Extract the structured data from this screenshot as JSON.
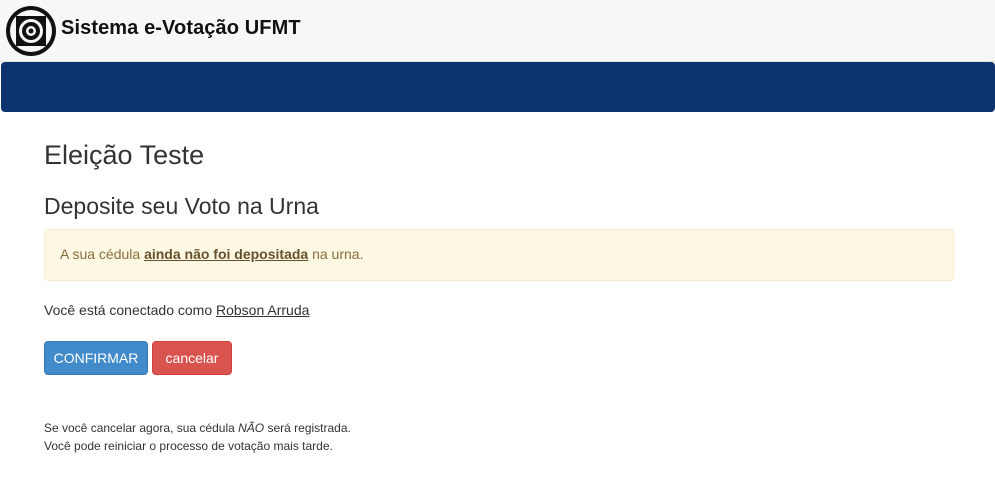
{
  "header": {
    "brand": "Sistema e-Votação UFMT",
    "logo_icon": "ufmt-logo-icon"
  },
  "colors": {
    "navbar": "#0d3370",
    "confirm_button": "#428bca",
    "cancel_button": "#d9534f",
    "alert_background": "#fcf8e3",
    "alert_text": "#8a6d3b"
  },
  "main": {
    "election_title": "Eleição Teste",
    "step_title": "Deposite seu Voto na Urna",
    "alert": {
      "prefix": "A sua cédula ",
      "emphasis": "ainda não foi depositada",
      "suffix": " na urna."
    },
    "connected": {
      "prefix": "Você está conectado como ",
      "user": "Robson Arruda"
    },
    "buttons": {
      "confirm": "CONFIRMAR",
      "cancel": "cancelar"
    },
    "note": {
      "line1_prefix": "Se você cancelar agora, sua cédula ",
      "line1_emphasis": "NÃO",
      "line1_suffix": " será registrada.",
      "line2": "Você pode reiniciar o processo de votação mais tarde."
    }
  }
}
